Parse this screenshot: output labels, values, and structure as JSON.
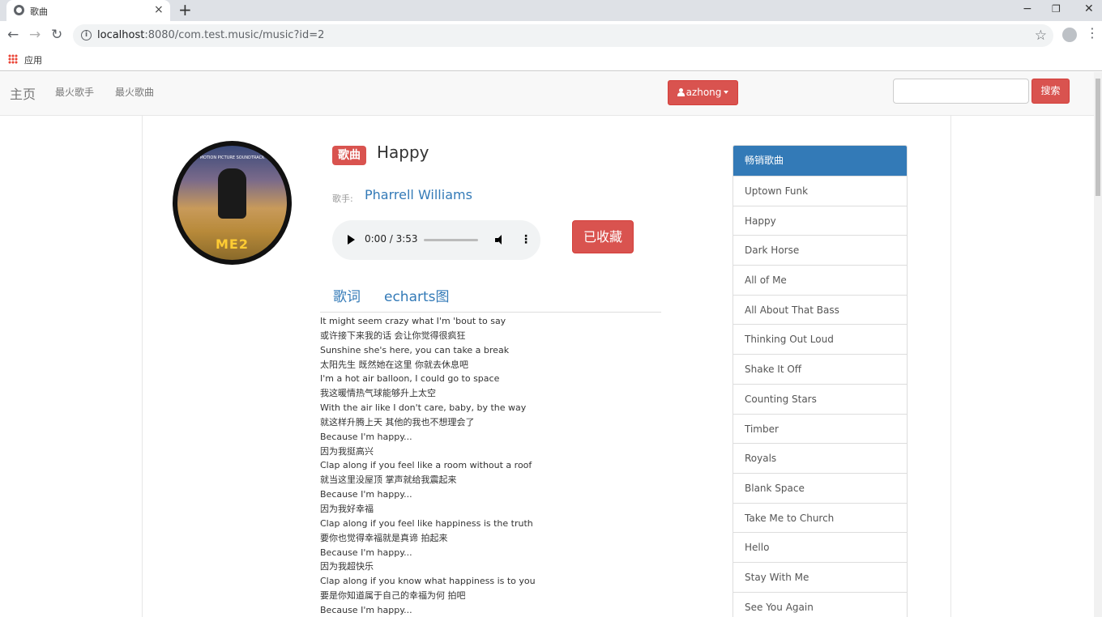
{
  "browser": {
    "tab_title": "歌曲",
    "tab_close": "×",
    "new_tab": "+",
    "window_controls": {
      "minimize": "−",
      "restore": "❐",
      "close": "✕"
    },
    "nav": {
      "back": "←",
      "forward": "→",
      "reload": "↻"
    },
    "url_host": "localhost",
    "url_rest": ":8080/com.test.music/music?id=2",
    "bookmarks_label": "应用"
  },
  "navbar": {
    "brand": "主页",
    "links": [
      "最火歌手",
      "最火歌曲"
    ],
    "user_name": "azhong",
    "search_value": "",
    "search_button": "搜索"
  },
  "song": {
    "badge": "歌曲",
    "title": "Happy",
    "singer_label": "歌手:",
    "singer": "Pharrell Williams",
    "cover_logo": "ME2",
    "cover_tagline": "MOTION PICTURE SOUNDTRACK",
    "player_time": "0:00 / 3:53",
    "progress_fraction": 0,
    "favorite_button": "已收藏"
  },
  "tabs": [
    "歌词",
    "echarts图"
  ],
  "lyrics": [
    "It might seem crazy what I'm 'bout to say",
    "或许接下来我的话 会让你觉得很疯狂",
    "Sunshine she's here, you can take a break",
    "太阳先生 既然她在这里 你就去休息吧",
    "I'm a hot air balloon, I could go to space",
    "我这暖情热气球能够升上太空",
    "With the air like I don't care, baby, by the way",
    "就这样升腾上天 其他的我也不想理会了",
    "Because I'm happy...",
    "因为我挺高兴",
    "Clap along if you feel like a room without a roof",
    "就当这里没屋顶 掌声就给我震起来",
    "Because I'm happy...",
    "因为我好幸福",
    "Clap along if you feel like happiness is the truth",
    "要你也觉得幸福就是真谛 拍起来",
    "Because I'm happy...",
    "因为我超快乐",
    "Clap along if you know what happiness is to you",
    "要是你知道属于自己的幸福为何 拍吧",
    "Because I'm happy..."
  ],
  "sidebar": {
    "heading": "畅销歌曲",
    "items": [
      "Uptown Funk",
      "Happy",
      "Dark Horse",
      "All of Me",
      "All About That Bass",
      "Thinking Out Loud",
      "Shake It Off",
      "Counting Stars",
      "Timber",
      "Royals",
      "Blank Space",
      "Take Me to Church",
      "Hello",
      "Stay With Me",
      "See You Again"
    ]
  },
  "colors": {
    "danger": "#d9534f",
    "primary": "#337ab7",
    "navbar_bg": "#f8f8f8"
  }
}
